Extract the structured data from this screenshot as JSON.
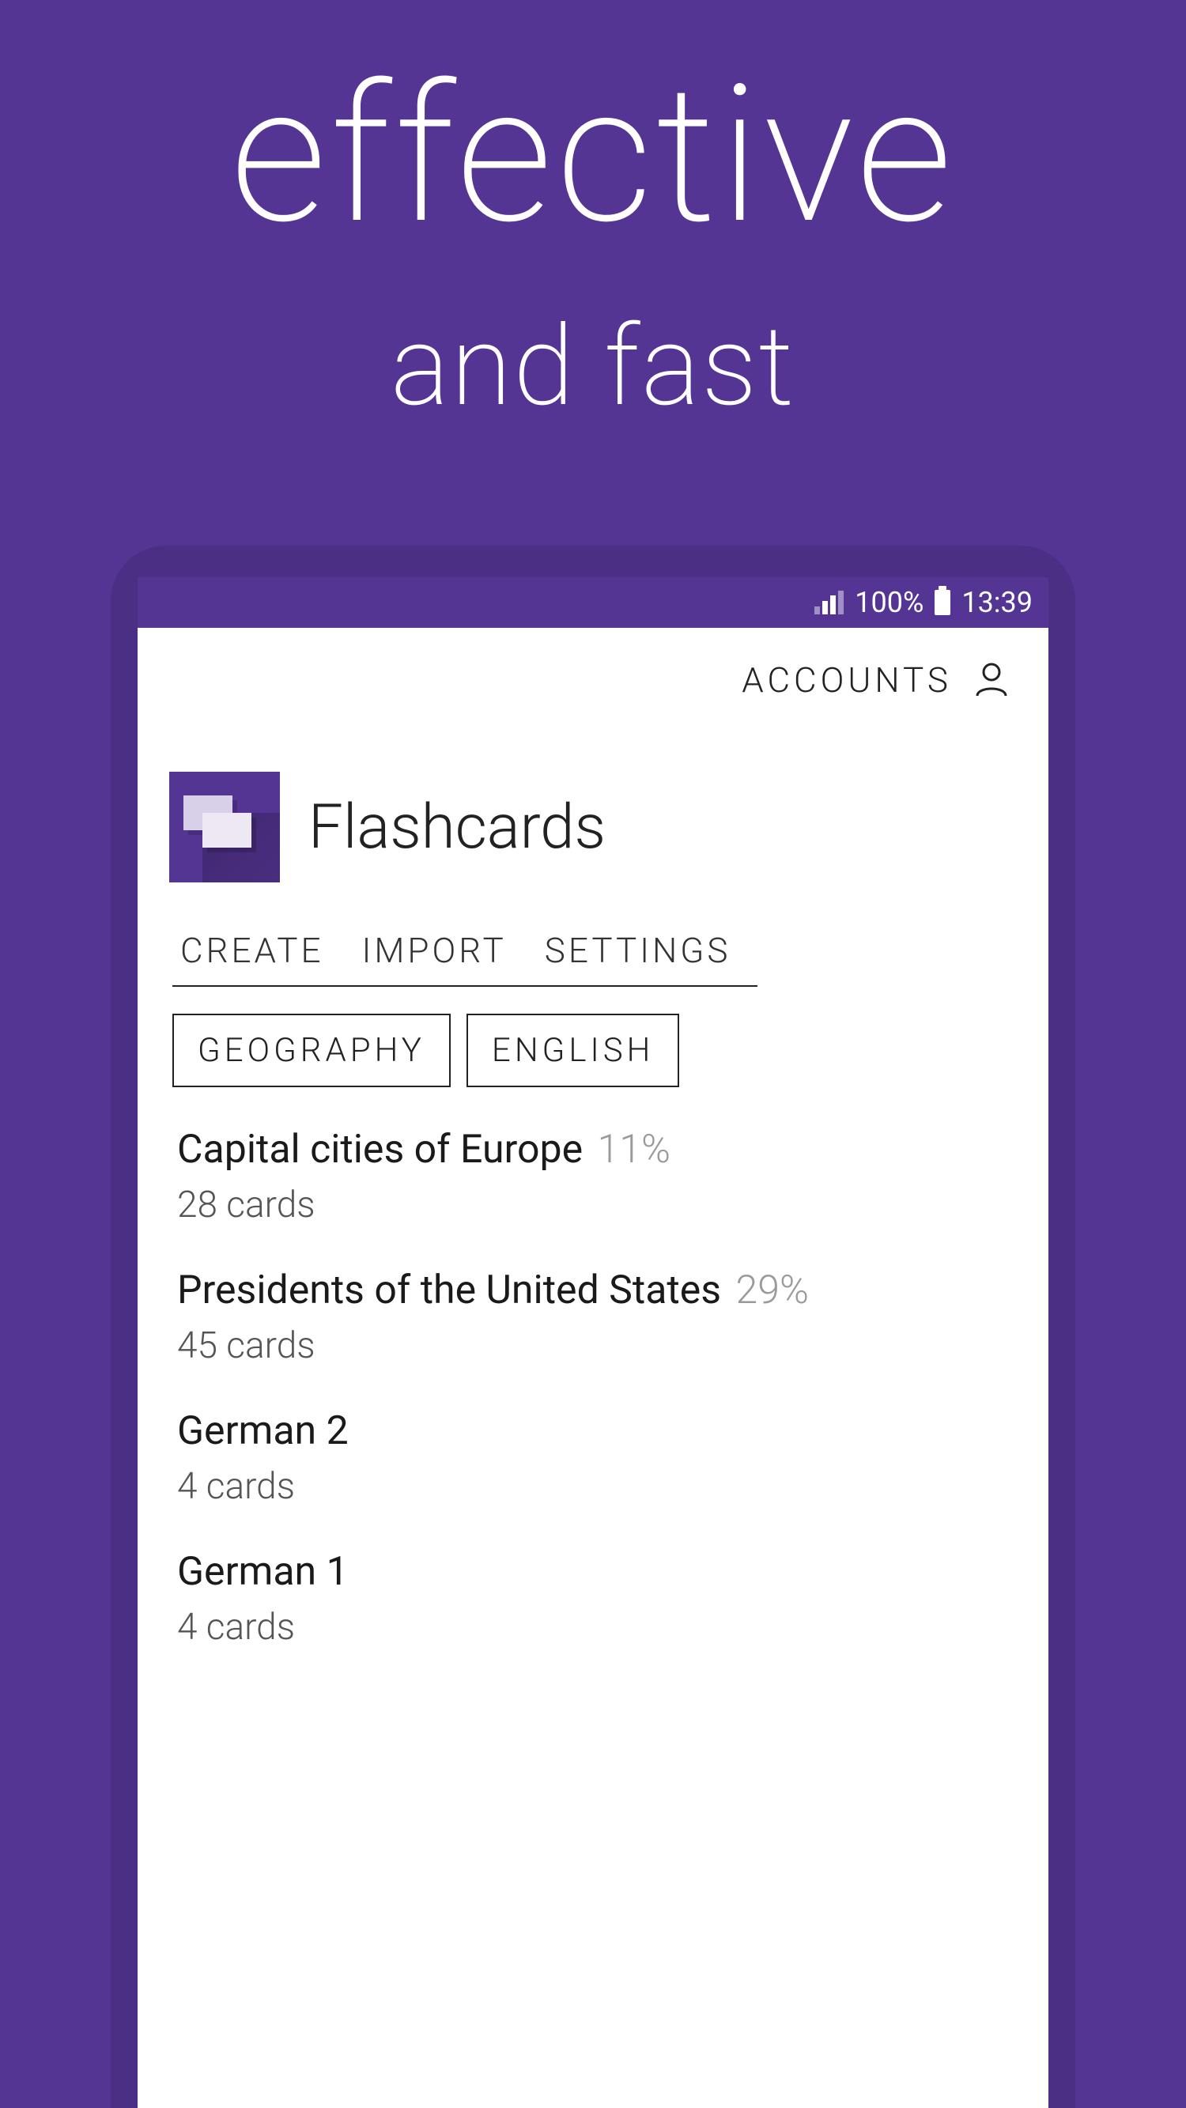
{
  "promo": {
    "line1": "effective",
    "line2": "and fast"
  },
  "statusbar": {
    "battery_pct": "100%",
    "time": "13:39"
  },
  "topbar": {
    "accounts_label": "ACCOUNTS"
  },
  "app": {
    "title": "Flashcards"
  },
  "actions": {
    "create": "CREATE",
    "import": "IMPORT",
    "settings": "SETTINGS"
  },
  "chips": {
    "geography": "GEOGRAPHY",
    "english": "ENGLISH"
  },
  "decks": [
    {
      "title": "Capital cities of Europe",
      "pct": "11%",
      "count": "28 cards"
    },
    {
      "title": "Presidents of the United States",
      "pct": "29%",
      "count": "45 cards"
    },
    {
      "title": "German 2",
      "pct": "",
      "count": "4 cards"
    },
    {
      "title": "German 1",
      "pct": "",
      "count": "4 cards"
    }
  ]
}
